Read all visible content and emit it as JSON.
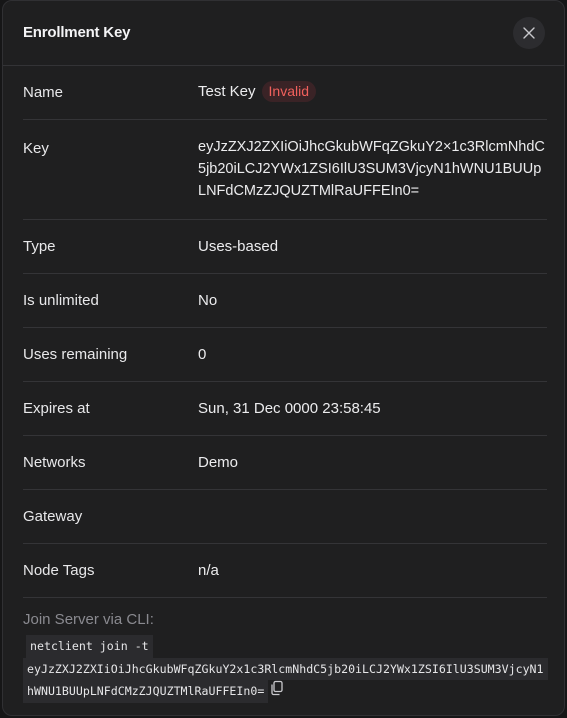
{
  "modal": {
    "title": "Enrollment Key"
  },
  "icons": {
    "close": "close-icon",
    "copy": "copy-icon"
  },
  "colors": {
    "invalid_badge_text": "#f0605c",
    "invalid_badge_bg": "#3a2326"
  },
  "details": {
    "name_label": "Name",
    "name_value": "Test Key",
    "status_badge": "Invalid",
    "key_label": "Key",
    "key_value": "eyJzZXJ2ZXIiOiJhcGkubWFqZGkuY2×1c3RlcmNhdC5jb20iLCJ2YWx1ZSI6IlU3SUM3VjcyN1hWNU1BUUpLNFdCMzZJQUZTMlRaUFFEIn0=",
    "type_label": "Type",
    "type_value": "Uses-based",
    "unlimited_label": "Is unlimited",
    "unlimited_value": "No",
    "uses_label": "Uses remaining",
    "uses_value": "0",
    "expires_label": "Expires at",
    "expires_value": "Sun, 31 Dec 0000 23:58:45",
    "networks_label": "Networks",
    "networks_value": "Demo",
    "gateway_label": "Gateway",
    "gateway_value": "",
    "tags_label": "Node Tags",
    "tags_value": "n/a"
  },
  "cli": {
    "label": "Join Server via CLI:",
    "line1": "netclient join -t",
    "line2": "eyJzZXJ2ZXIiOiJhcGkubWFqZGkuY2x1c3RlcmNhdC5jb20iLCJ2YWx1ZSI6IlU3SUM3VjcyN1",
    "line3": "hWNU1BUUpLNFdCMzZJQUZTMlRaUFFEIn0="
  }
}
